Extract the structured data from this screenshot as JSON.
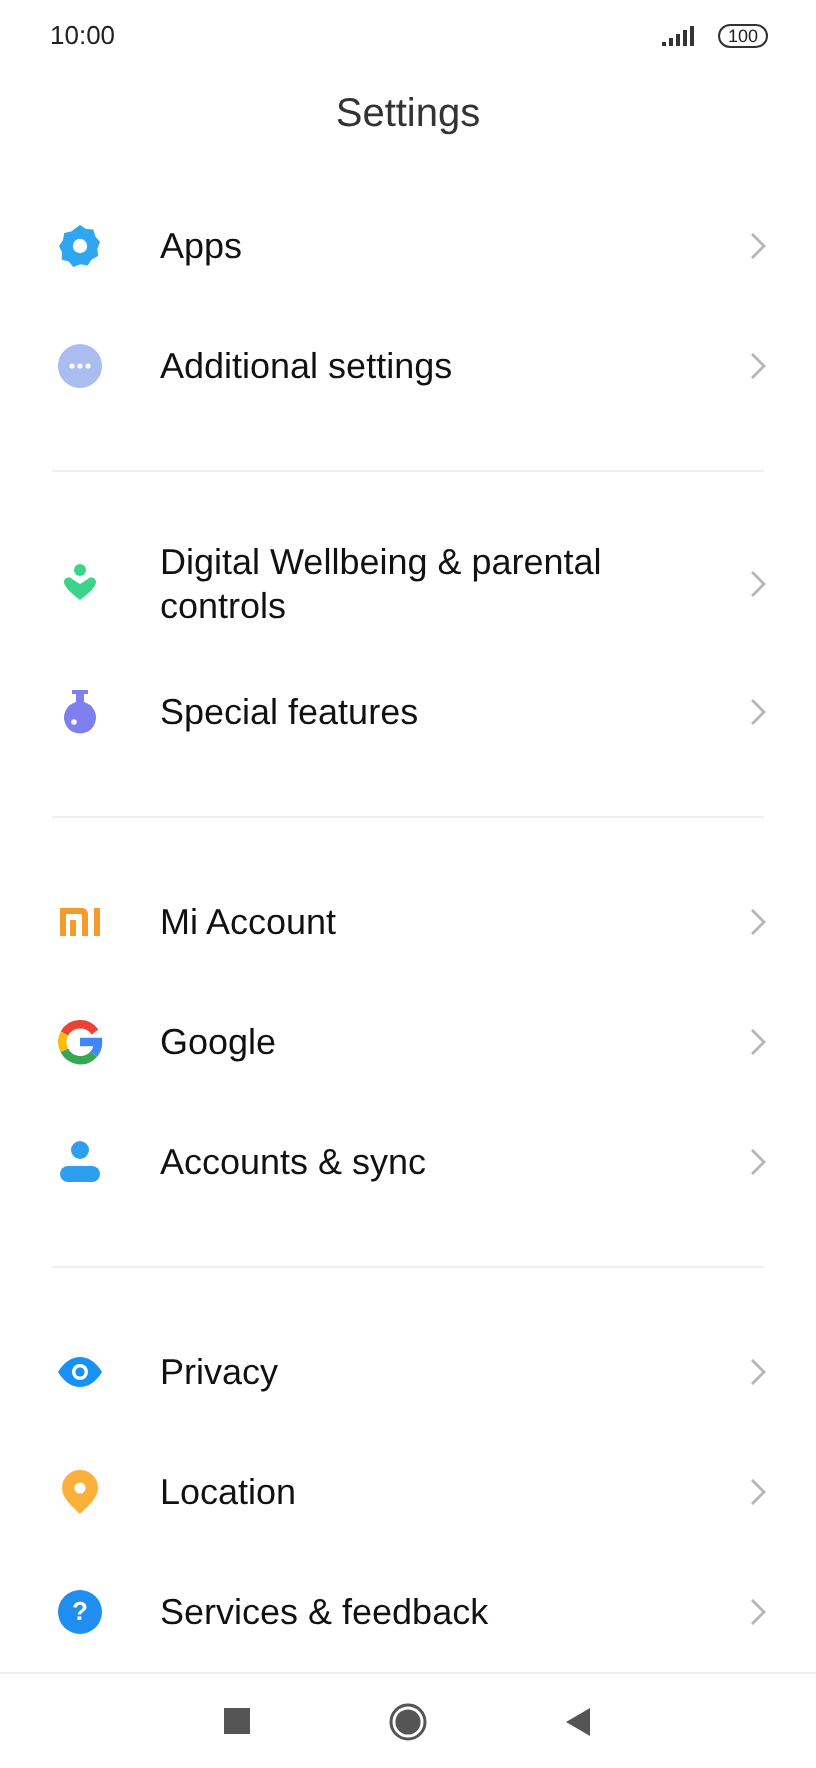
{
  "status_bar": {
    "time": "10:00",
    "battery": "100"
  },
  "title": "Settings",
  "groups": [
    {
      "items": [
        {
          "label": "Apps"
        },
        {
          "label": "Additional settings"
        }
      ]
    },
    {
      "items": [
        {
          "label": "Digital Wellbeing & parental controls"
        },
        {
          "label": "Special features"
        }
      ]
    },
    {
      "items": [
        {
          "label": "Mi Account"
        },
        {
          "label": "Google"
        },
        {
          "label": "Accounts & sync"
        }
      ]
    },
    {
      "items": [
        {
          "label": "Privacy"
        },
        {
          "label": "Location"
        },
        {
          "glyph": "?",
          "label": "Services & feedback"
        }
      ]
    }
  ]
}
